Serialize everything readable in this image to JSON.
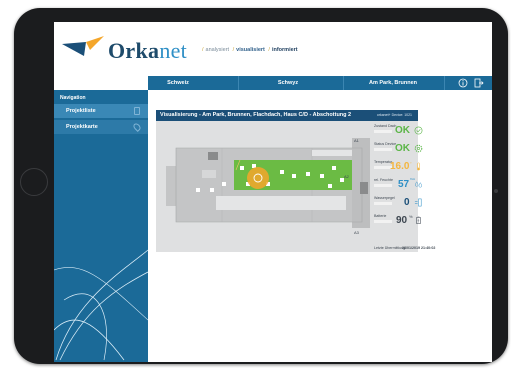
{
  "app": {
    "logo_word_1": "Orka",
    "logo_word_2": "net"
  },
  "breadcrumbs": [
    "analysiert",
    "visualisiert",
    "informiert"
  ],
  "topnav": {
    "tabs": [
      "Schweiz",
      "Schwyz",
      "Am Park, Brunnen"
    ],
    "icons": [
      "info-icon",
      "logout-icon"
    ]
  },
  "sidebar": {
    "heading": "Navigation",
    "items": [
      {
        "label": "Projektliste",
        "icon": "document-icon"
      },
      {
        "label": "Projektkarte",
        "icon": "map-icon"
      }
    ]
  },
  "panel": {
    "title": "Visualisierung - Am Park, Brunnen, Flachdach, Haus C/D - Abschottung 2",
    "device": "orkanet+ Device: 1021",
    "zones": [
      "A1",
      "A2",
      "A3"
    ]
  },
  "status": {
    "rows": [
      {
        "label": "Zustand Dach",
        "value": "OK",
        "unit": "",
        "color": "#5bb547",
        "icon": "check-circle-icon"
      },
      {
        "label": "Status Device",
        "value": "OK",
        "unit": "",
        "color": "#5bb547",
        "icon": "gear-icon"
      },
      {
        "label": "Temperatur",
        "value": "16.0",
        "unit": "°",
        "color": "#f4b63f",
        "icon": "thermometer-icon"
      },
      {
        "label": "rel. Feuchte",
        "value": "57",
        "unit": "%rH",
        "color": "#2e8fc6",
        "icon": "humidity-icon"
      },
      {
        "label": "Wasserpegel",
        "value": "0",
        "unit": "",
        "color": "#1b4f78",
        "icon": "water-level-icon"
      },
      {
        "label": "Batterie",
        "value": "90",
        "unit": "%",
        "color": "#3d4650",
        "icon": "battery-icon"
      }
    ],
    "last_update_label": "Letzte Übermittlung",
    "last_update_value": "28/01/2019 21:40:02"
  },
  "colors": {
    "primary": "#1b6a98",
    "dark": "#1b4f78",
    "accent": "#f4a62a",
    "ok": "#5bb547",
    "roof_green": "#6bbb44"
  }
}
